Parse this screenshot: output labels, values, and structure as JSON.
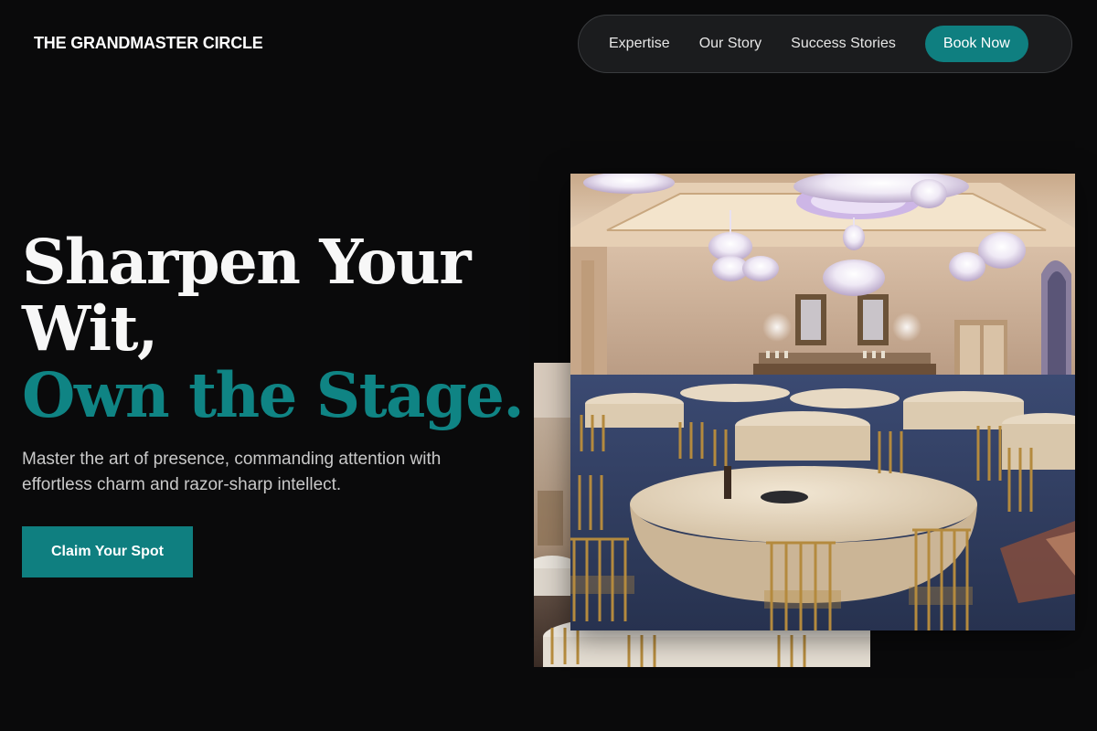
{
  "brand": {
    "name": "THE GRANDMASTER CIRCLE"
  },
  "nav": {
    "links": [
      "Expertise",
      "Our Story",
      "Success Stories"
    ],
    "cta_label": "Book Now"
  },
  "hero": {
    "headline_line1": "Sharpen Your",
    "headline_line2": "Wit,",
    "headline_accent": "Own the Stage.",
    "subtitle": "Master the art of presence, commanding attention with effortless charm and razor-sharp intellect.",
    "cta_label": "Claim Your Spot"
  },
  "colors": {
    "background": "#0a0a0b",
    "accent": "#0f7f80",
    "nav_background": "#1b1c1e"
  }
}
